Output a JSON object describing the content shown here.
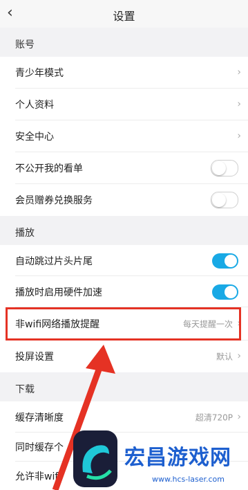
{
  "header": {
    "title": "设置",
    "back_icon": "chevron-left-icon"
  },
  "sections": {
    "account": "账号",
    "playback": "播放",
    "download": "下载"
  },
  "rows": {
    "youth_mode": "青少年模式",
    "profile": "个人资料",
    "security": "安全中心",
    "private_list": "不公开我的看单",
    "coupon": "会员赠券兑换服务",
    "skip_intro": "自动跳过片头片尾",
    "hw_accel": "播放时启用硬件加速",
    "non_wifi": "非wifi网络播放提醒",
    "non_wifi_value": "每天提醒一次",
    "cast": "投屏设置",
    "cast_value": "默认",
    "cache_quality": "缓存清晰度",
    "cache_quality_value": "超清720P",
    "concurrent": "同时缓存个",
    "allow_non_wifi": "允许非wifi"
  },
  "toggles": {
    "private_list": false,
    "coupon": false,
    "skip_intro": true,
    "hw_accel": true
  },
  "watermark": {
    "title": "宏昌游戏网",
    "url": "www.hcs-laser.com"
  },
  "colors": {
    "accent": "#19a9e5",
    "highlight": "#e53224",
    "watermark": "#1d5fcf"
  }
}
